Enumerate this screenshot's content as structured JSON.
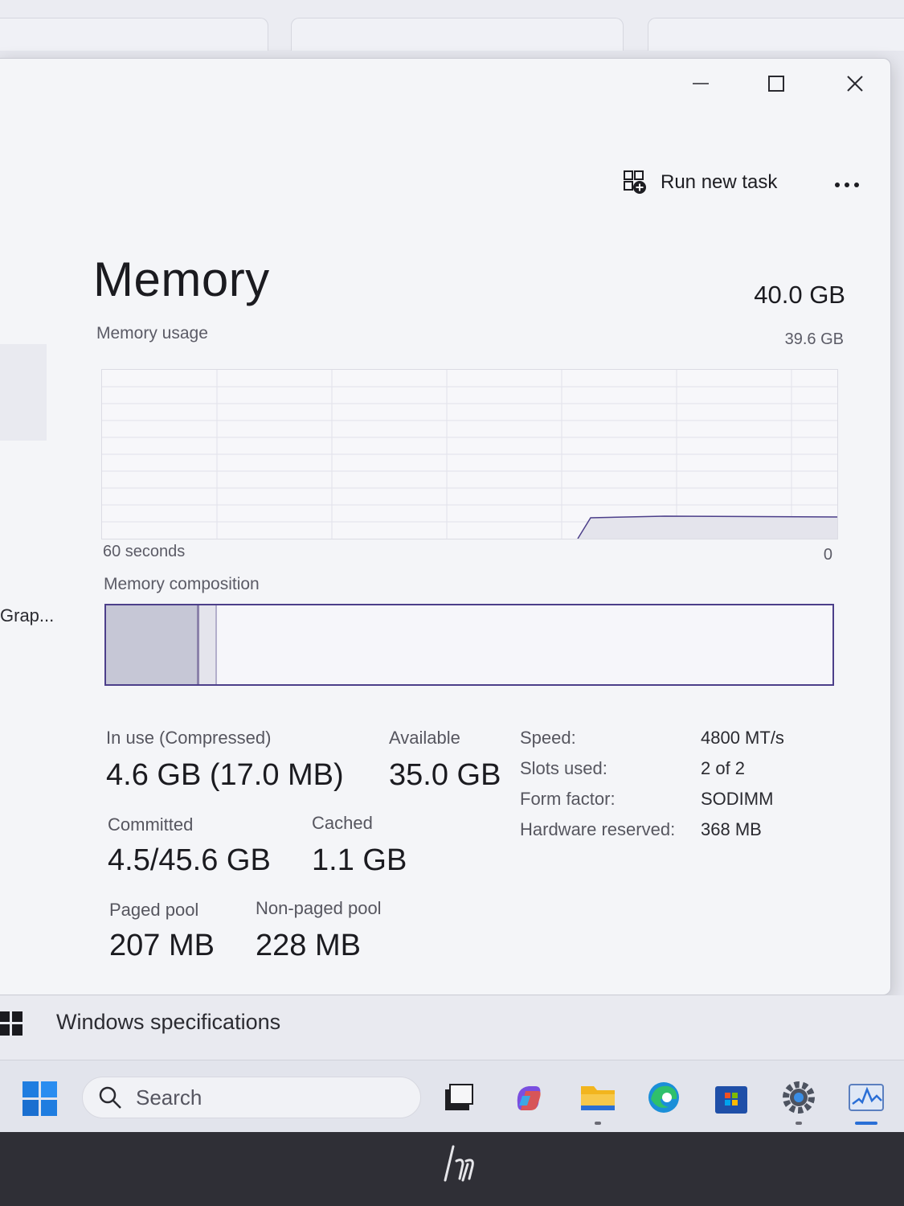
{
  "toolbar": {
    "run_new_task_label": "Run new task"
  },
  "memory": {
    "title": "Memory",
    "total_capacity": "40.0 GB",
    "usage_label": "Memory usage",
    "usage_max": "39.6 GB",
    "axis_left": "60 seconds",
    "axis_right": "0",
    "composition_label": "Memory composition",
    "stats": {
      "in_use_label": "In use (Compressed)",
      "in_use_value": "4.6 GB (17.0 MB)",
      "available_label": "Available",
      "available_value": "35.0 GB",
      "committed_label": "Committed",
      "committed_value": "4.5/45.6 GB",
      "cached_label": "Cached",
      "cached_value": "1.1 GB",
      "paged_pool_label": "Paged pool",
      "paged_pool_value": "207 MB",
      "non_paged_pool_label": "Non-paged pool",
      "non_paged_pool_value": "228 MB"
    },
    "specs": [
      {
        "label": "Speed:",
        "value": "4800 MT/s"
      },
      {
        "label": "Slots used:",
        "value": "2 of 2"
      },
      {
        "label": "Form factor:",
        "value": "SODIMM"
      },
      {
        "label": "Hardware reserved:",
        "value": "368 MB"
      }
    ]
  },
  "sidebar_peek": {
    "item_label": "Grap..."
  },
  "background_window": {
    "item_label": "Windows specifications"
  },
  "taskbar": {
    "search_placeholder": "Search",
    "apps": [
      "task-view",
      "copilot",
      "file-explorer",
      "edge",
      "microsoft-store",
      "settings",
      "task-manager"
    ]
  },
  "colors": {
    "memory_accent": "#4c3f8a",
    "in_use_fill": "#c6c7d6",
    "window_background": "#f4f5f8"
  }
}
